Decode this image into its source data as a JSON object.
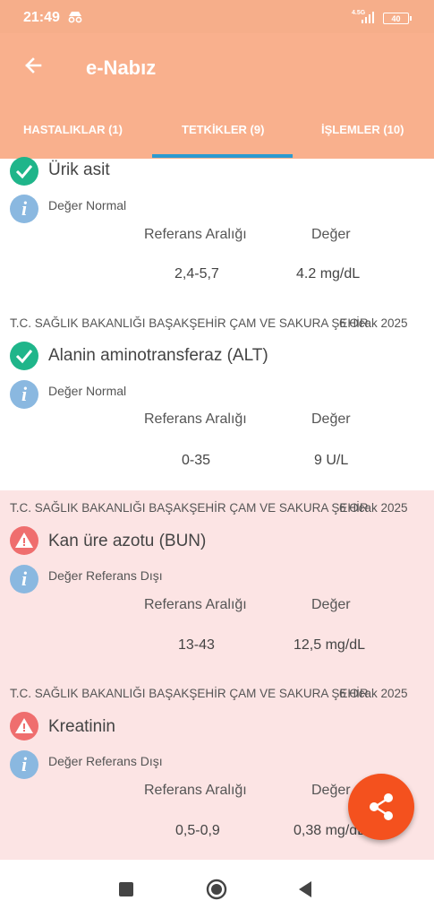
{
  "status_bar": {
    "time": "21:49",
    "network": "4.5G",
    "battery": "40"
  },
  "app": {
    "title": "e-Nabız"
  },
  "tabs": [
    {
      "label": "HASTALIKLAR (1)"
    },
    {
      "label": "TETKİKLER (9)"
    },
    {
      "label": "İŞLEMLER (10)"
    }
  ],
  "columns": {
    "range": "Referans Aralığı",
    "value": "Değer"
  },
  "tests": [
    {
      "hospital": "",
      "date": "",
      "name": "Ürik asit",
      "status": "Değer Normal",
      "range": "2,4-5,7",
      "value": "4.2 mg/dL"
    },
    {
      "hospital": "T.C. SAĞLIK BAKANLIĞI BAŞAKŞEHİR ÇAM VE SAKURA ŞEHİR",
      "date": "6 Ocak 2025",
      "name": "Alanin aminotransferaz (ALT)",
      "status": "Değer Normal",
      "range": "0-35",
      "value": "9 U/L"
    },
    {
      "hospital": "T.C. SAĞLIK BAKANLIĞI BAŞAKŞEHİR ÇAM VE SAKURA ŞEHİR",
      "date": "6 Ocak 2025",
      "name": "Kan üre azotu (BUN)",
      "status": "Değer Referans Dışı",
      "range": "13-43",
      "value": "12,5 mg/dL"
    },
    {
      "hospital": "T.C. SAĞLIK BAKANLIĞI BAŞAKŞEHİR ÇAM VE SAKURA ŞEHİR",
      "date": "6 Ocak 2025",
      "name": "Kreatinin",
      "status": "Değer Referans Dışı",
      "range": "0,5-0,9",
      "value": "0,38 mg/dL"
    }
  ],
  "colors": {
    "header": "#F9B08D",
    "tab_indicator": "#2A9AD0",
    "normal": "#1FB58A",
    "abnormal": "#EF6E6E",
    "abnormal_bg": "#FCE4E4",
    "fab": "#F4511E"
  },
  "icons": [
    "back-arrow-icon",
    "check-icon",
    "warning-icon",
    "info-icon",
    "share-icon"
  ]
}
